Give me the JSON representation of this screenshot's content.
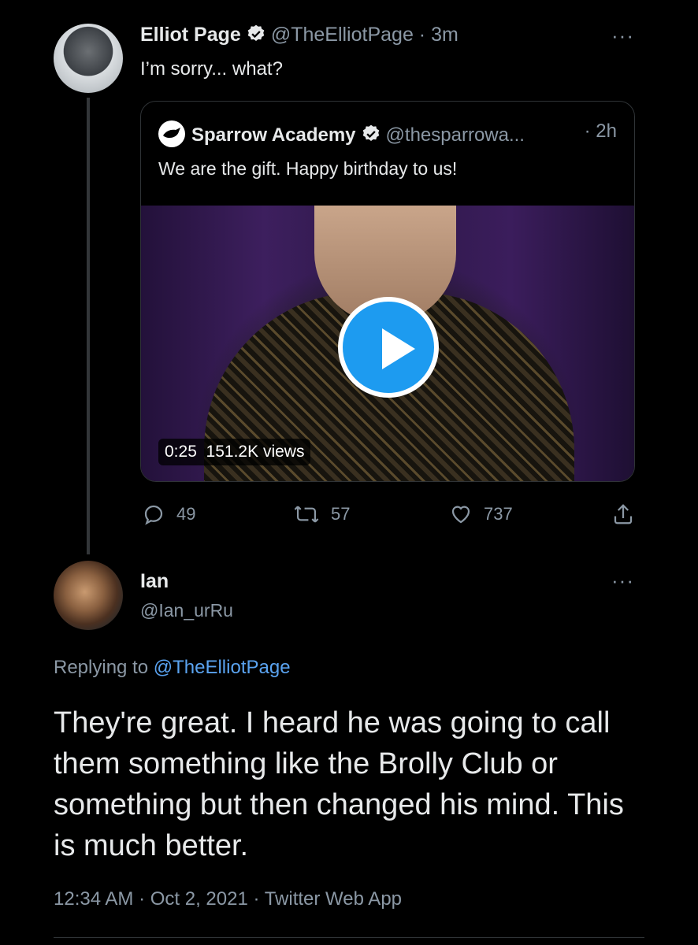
{
  "tweet": {
    "name": "Elliot Page",
    "handle": "@TheElliotPage",
    "time": "· 3m",
    "text": "I’m sorry... what?",
    "more": "···",
    "quote": {
      "name": "Sparrow Academy",
      "handle": "@thesparrowa...",
      "time": "· 2h",
      "text": "We are the gift. Happy birthday to us!",
      "video_duration": "0:25",
      "video_views": "151.2K views"
    },
    "actions": {
      "replies": "49",
      "retweets": "57",
      "likes": "737"
    }
  },
  "reply": {
    "name": "Ian",
    "handle": "@Ian_urRu",
    "more": "···",
    "replying_prefix": "Replying to",
    "replying_handle": "@TheElliotPage",
    "text": "They're great. I heard he was going to call them something like the Brolly Club or something but then changed his mind. This is much better.",
    "timestamp": "12:34 AM · Oct 2, 2021 · Twitter Web App"
  },
  "colors": {
    "background": "#000000",
    "muted": "#8b98a5",
    "link": "#5aa3f0",
    "play": "#1d9bf0"
  }
}
